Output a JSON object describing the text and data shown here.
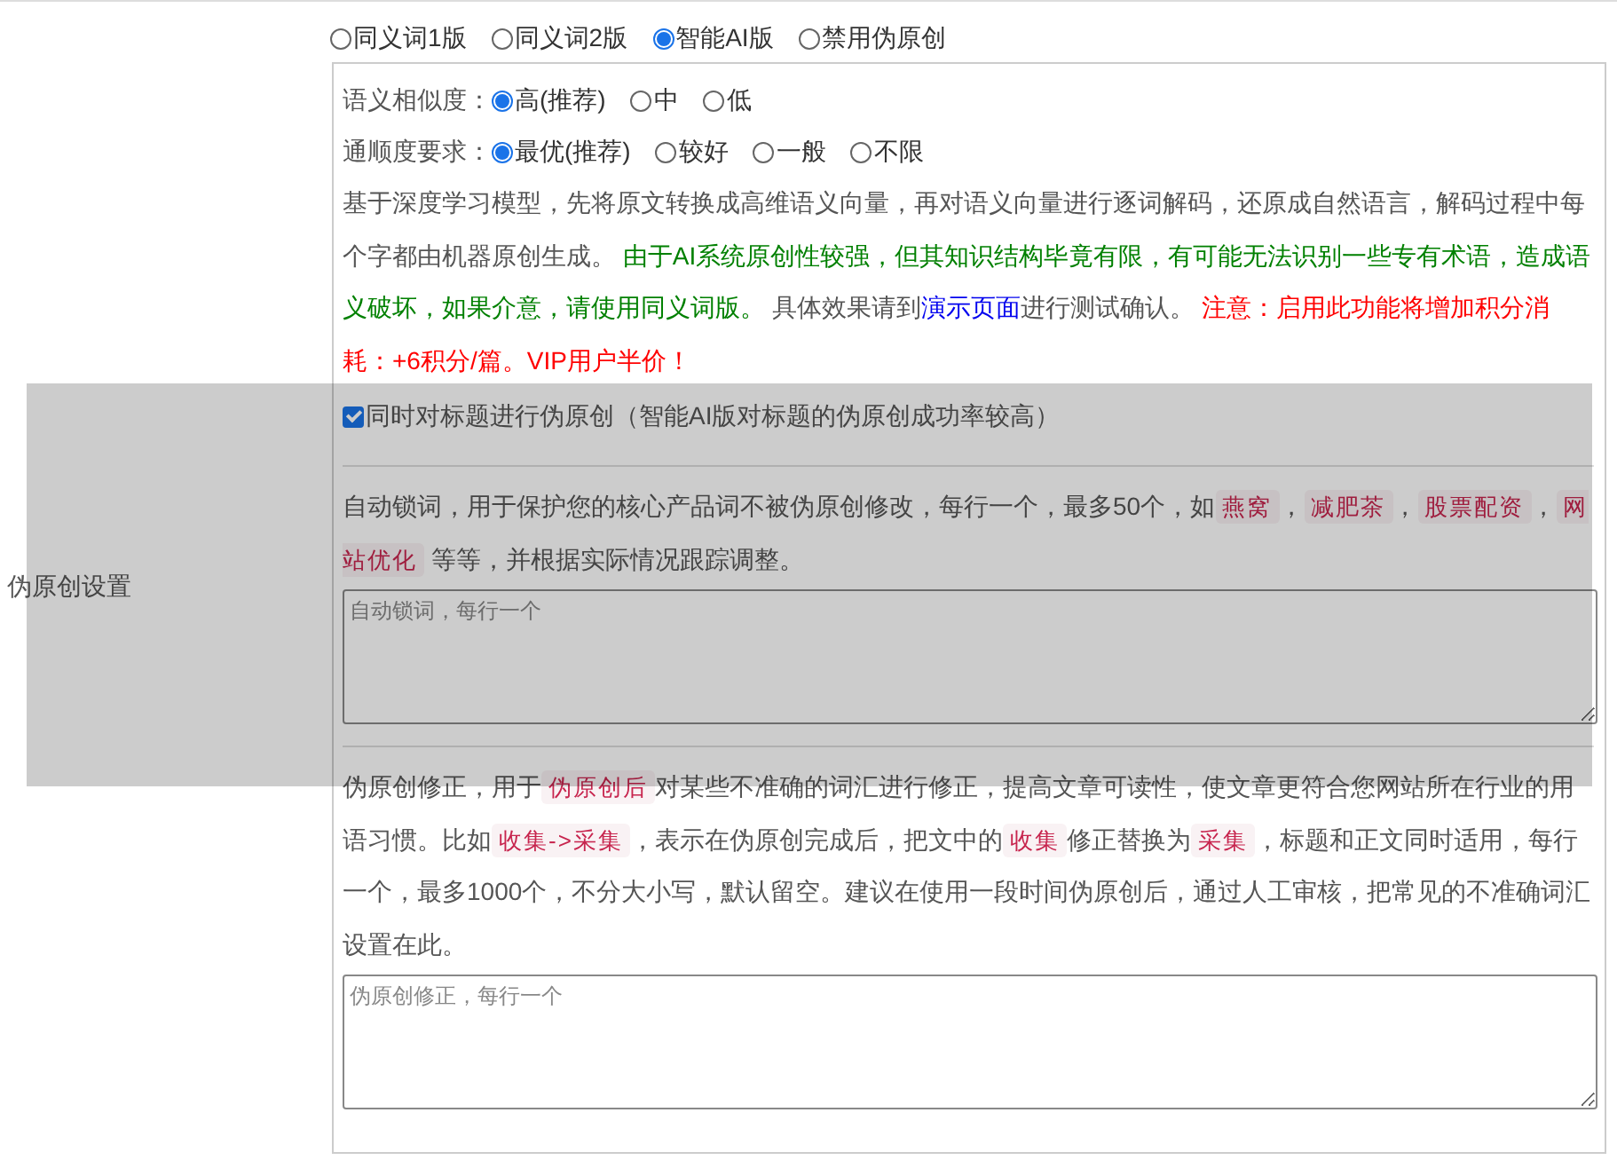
{
  "mode_options": [
    {
      "label": "同义词1版",
      "selected": false
    },
    {
      "label": "同义词2版",
      "selected": false
    },
    {
      "label": "智能AI版",
      "selected": true
    },
    {
      "label": "禁用伪原创",
      "selected": false
    }
  ],
  "section_label": "伪原创设置",
  "similarity": {
    "label": "语义相似度：",
    "options": [
      {
        "label": "高(推荐)",
        "selected": true
      },
      {
        "label": "中",
        "selected": false
      },
      {
        "label": "低",
        "selected": false
      }
    ]
  },
  "fluency": {
    "label": "通顺度要求：",
    "options": [
      {
        "label": "最优(推荐)",
        "selected": true
      },
      {
        "label": "较好",
        "selected": false
      },
      {
        "label": "一般",
        "selected": false
      },
      {
        "label": "不限",
        "selected": false
      }
    ]
  },
  "description": [
    {
      "kind": "plain",
      "text": "基于深度学习模型，先将原文转换成高维语义向量，再对语义向量进行逐词解码，还原成自然语言，解码过程中每个字都由机器原创生成。 "
    },
    {
      "kind": "notice",
      "text": "由于AI系统原创性较强，但其知识结构毕竟有限，有可能无法识别一些专有术语，造成语义破坏，如果介意，请使用同义词版。"
    },
    {
      "kind": "plain",
      "text": " 具体效果请到"
    },
    {
      "kind": "link",
      "text": "演示页面"
    },
    {
      "kind": "plain",
      "text": "进行测试确认。 "
    },
    {
      "kind": "warning",
      "text": "注意：启用此功能将增加积分消耗：+6积分/篇。VIP用户半价！"
    }
  ],
  "title_option": {
    "label": "同时对标题进行伪原创（智能AI版对标题的伪原创成功率较高）",
    "checked": true
  },
  "disabled_mask": true,
  "lock_words": {
    "description": [
      {
        "kind": "plain",
        "text": "自动锁词，用于保护您的核心产品词不被伪原创修改，每行一个，最多50个，如"
      },
      {
        "kind": "code",
        "text": "燕窝"
      },
      {
        "kind": "plain",
        "text": "，"
      },
      {
        "kind": "code",
        "text": "减肥茶"
      },
      {
        "kind": "plain",
        "text": "，"
      },
      {
        "kind": "code",
        "text": "股票配资"
      },
      {
        "kind": "plain",
        "text": "，"
      },
      {
        "kind": "code",
        "text": "网站优化"
      },
      {
        "kind": "plain",
        "text": " 等等，并根据实际情况跟踪调整。"
      }
    ],
    "placeholder": "自动锁词，每行一个"
  },
  "corrections": {
    "description": [
      {
        "kind": "plain",
        "text": "伪原创修正，用于"
      },
      {
        "kind": "code",
        "text": "伪原创后"
      },
      {
        "kind": "plain",
        "text": "对某些不准确的词汇进行修正，提高文章可读性，使文章更符合您网站所在行业的用语习惯。比如"
      },
      {
        "kind": "code",
        "text": "收集->采集"
      },
      {
        "kind": "plain",
        "text": "，表示在伪原创完成后，把文中的"
      },
      {
        "kind": "code",
        "text": "收集"
      },
      {
        "kind": "plain",
        "text": "修正替换为"
      },
      {
        "kind": "code",
        "text": "采集"
      },
      {
        "kind": "plain",
        "text": "，标题和正文同时适用，每行一个，最多1000个，不分大小写，默认留空。建议在使用一段时间伪原创后，通过人工审核，把常见的不准确词汇设置在此。"
      }
    ],
    "placeholder": "伪原创修正，每行一个"
  }
}
